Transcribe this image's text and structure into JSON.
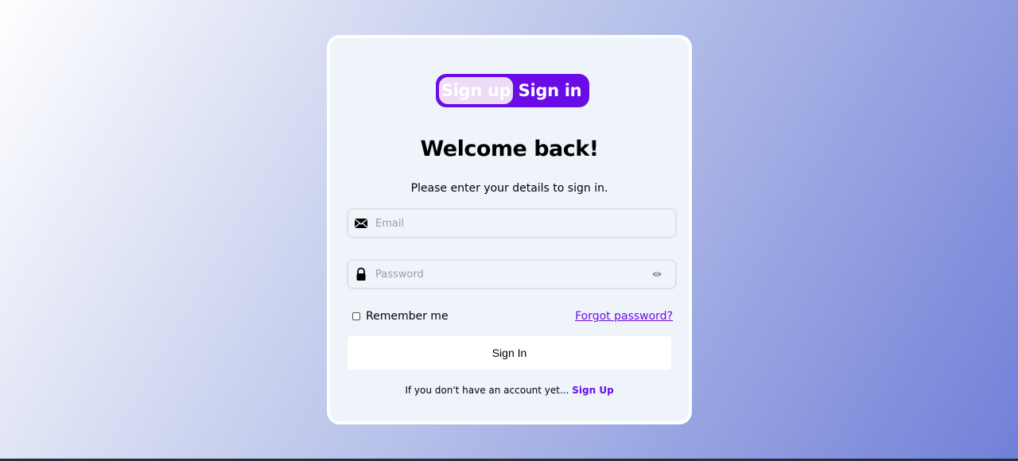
{
  "toggle": {
    "signup_label": "Sign up",
    "signin_label": "Sign in",
    "active": "Sign in"
  },
  "heading": {
    "title": "Welcome back!",
    "subtitle": "Please enter your details to sign in."
  },
  "form": {
    "email": {
      "placeholder": "Email",
      "value": "",
      "icon": "envelope-icon"
    },
    "password": {
      "placeholder": "Password",
      "value": "",
      "icon": "lock-icon",
      "toggle_icon": "eye-icon"
    },
    "remember_label": "Remember me",
    "remember_checked": false,
    "forgot_label": "Forgot password?",
    "submit_label": "Sign In"
  },
  "footer": {
    "prompt": "If you don't have an account yet...",
    "link_label": "Sign Up"
  },
  "colors": {
    "accent": "#6a0ce6",
    "card_bg": "#eff4fb",
    "pill_highlight": "#ecdcf7"
  }
}
